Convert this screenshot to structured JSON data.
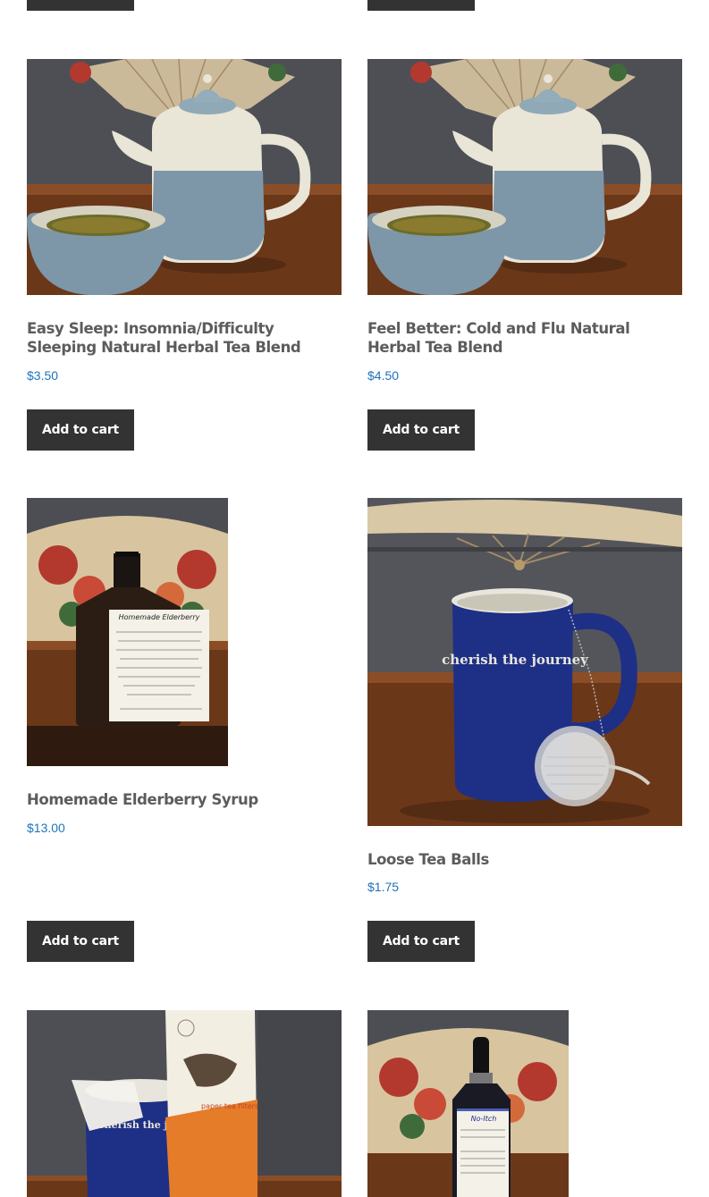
{
  "add_to_cart_label": "Add to cart",
  "products": [
    {
      "title": "Easy Sleep: Insomnia/Difficulty Sleeping Natural Herbal Tea Blend",
      "price": "$3.50"
    },
    {
      "title": "Feel Better: Cold and Flu Natural Herbal Tea Blend",
      "price": "$4.50"
    },
    {
      "title": "Homemade Elderberry Syrup",
      "price": "$13.00",
      "image_label_line1": "Homemade Elderberry"
    },
    {
      "title": "Loose Tea Balls",
      "price": "$1.75",
      "image_label_line1": "cherish the journey"
    },
    {
      "image_label_line1": "cherish the journey",
      "image_label_line2": "paper tea filters"
    },
    {
      "image_label_line1": "No-Itch"
    }
  ],
  "colors": {
    "price": "#1e73be",
    "button_bg": "#333333",
    "title": "#5c5c5c"
  }
}
